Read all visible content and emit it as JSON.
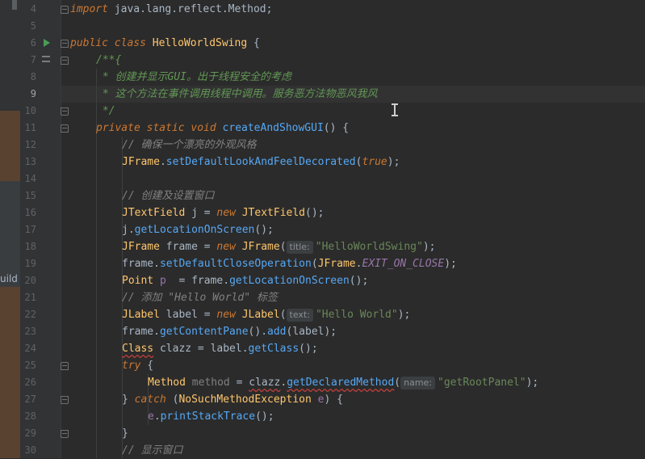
{
  "left_panel": {
    "truncated_label": "uild"
  },
  "line_numbers": [
    "4",
    "5",
    "6",
    "7",
    "8",
    "9",
    "10",
    "11",
    "12",
    "13",
    "14",
    "15",
    "16",
    "17",
    "18",
    "19",
    "20",
    "21",
    "22",
    "23",
    "24",
    "25",
    "26",
    "27",
    "28",
    "29",
    "30"
  ],
  "code": {
    "l4_import": "import",
    "l4_rest": " java.lang.reflect.Method;",
    "l6_public": "public",
    "l6_class": "class",
    "l6_name": "HelloWorldSwing",
    "l6_brace": " {",
    "l7": "/**{",
    "l8": " * 创建并显示GUI。出于线程安全的考虑",
    "l9": " * 这个方法在事件调用线程中调用。服务恶方法物恶风我风",
    "l10": " */",
    "l11_mods": "private static void",
    "l11_fn": "createAndShowGUI",
    "l11_rest": "() {",
    "l12": "// 确保一个漂亮的外观风格",
    "l13_cls": "JFrame",
    "l13_fn": "setDefaultLookAndFeelDecorated",
    "l13_true": "true",
    "l15": "// 创建及设置窗口",
    "l16_cls": "JTextField",
    "l16_a": " j = ",
    "l16_new": "new",
    "l16_ctor": "JTextField",
    "l16_b": "();",
    "l17_a": "j.",
    "l17_fn": "getLocationOnScreen",
    "l17_b": "();",
    "l18_cls": "JFrame",
    "l18_a": " frame = ",
    "l18_new": "new",
    "l18_ctor": "JFrame",
    "l18_hint": "title:",
    "l18_str": "\"HelloWorldSwing\"",
    "l19_a": "frame.",
    "l19_fn": "setDefaultCloseOperation",
    "l19_cls": "JFrame",
    "l19_const": "EXIT_ON_CLOSE",
    "l20_cls": "Point",
    "l20_var": "p",
    "l20_a": "  = frame.",
    "l20_fn": "getLocationOnScreen",
    "l20_b": "();",
    "l21": "// 添加 \"Hello World\" 标签",
    "l22_cls": "JLabel",
    "l22_a": " label = ",
    "l22_new": "new",
    "l22_ctor": "JLabel",
    "l22_hint": "text:",
    "l22_str": "\"Hello World\"",
    "l23_a": "frame.",
    "l23_fn1": "getContentPane",
    "l23_fn2": "add",
    "l23_b": "(label);",
    "l24_cls": "Class",
    "l24_a": " clazz = label.",
    "l24_fn": "getClass",
    "l24_b": "();",
    "l25_try": "try",
    "l26_cls": "Method",
    "l26_var": "method",
    "l26_a": " = ",
    "l26_clazz": "clazz",
    "l26_fn": "getDeclaredMethod",
    "l26_hint": "name:",
    "l26_str": "\"getRootPanel\"",
    "l27_catch": "catch",
    "l27_cls": "NoSuchMethodException",
    "l27_var": "e",
    "l28_var": "e",
    "l28_fn": "printStackTrace",
    "l29": "}",
    "l30": "// 显示窗口"
  }
}
